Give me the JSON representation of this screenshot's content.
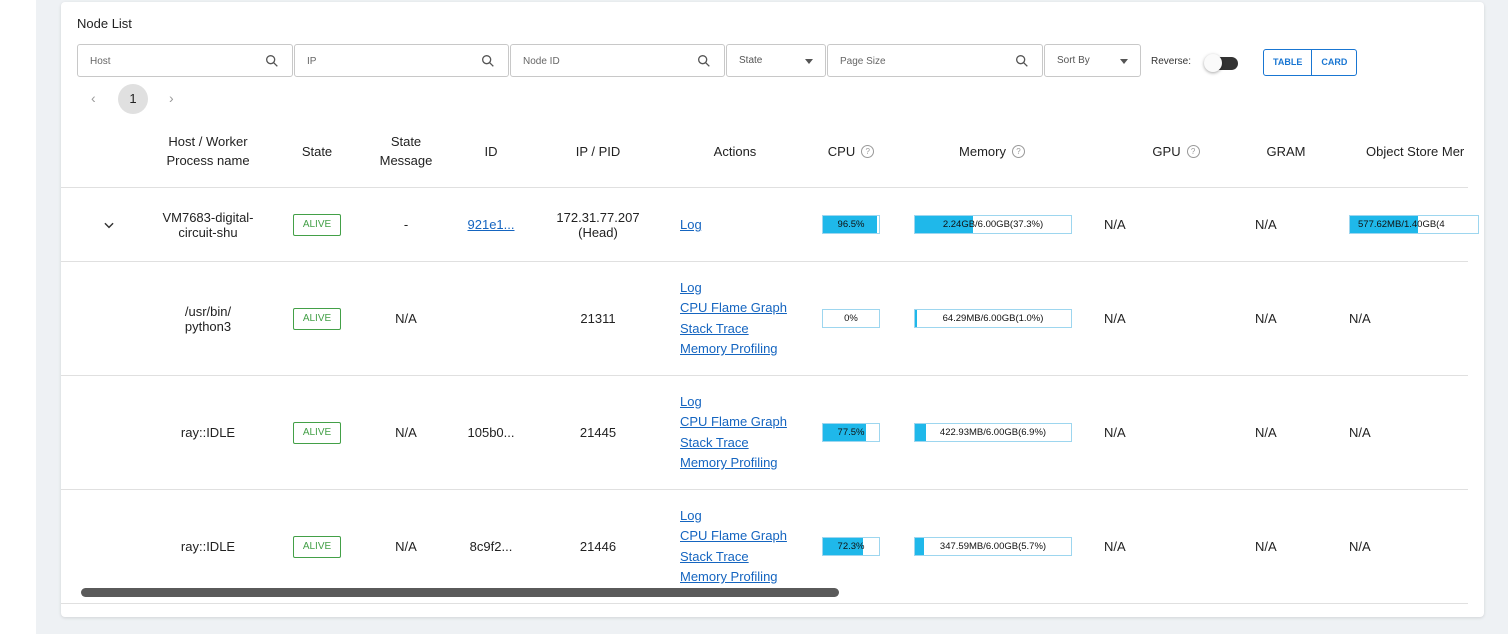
{
  "card_title": "Node List",
  "filters": {
    "host": {
      "placeholder": "Host"
    },
    "ip": {
      "placeholder": "IP"
    },
    "node_id": {
      "placeholder": "Node ID"
    },
    "state": {
      "value": "State"
    },
    "page_size": {
      "placeholder": "Page Size"
    },
    "sort_by": {
      "value": "Sort By"
    },
    "reverse_label": "Reverse:",
    "reverse_on": false,
    "view_table": "TABLE",
    "view_card": "CARD"
  },
  "pagination": {
    "prev": "‹",
    "current": "1",
    "next": "›"
  },
  "columns": {
    "host": [
      "Host / Worker",
      "Process name"
    ],
    "state": "State",
    "state_message": [
      "State",
      "Message"
    ],
    "id": "ID",
    "ip_pid": "IP / PID",
    "actions": "Actions",
    "cpu": "CPU",
    "memory": "Memory",
    "gpu": "GPU",
    "gram": "GRAM",
    "object_store": "Object Store Mer"
  },
  "node_row": {
    "host": [
      "VM7683-digital-",
      "circuit-shu"
    ],
    "state": "ALIVE",
    "state_message": "-",
    "id": "921e1...",
    "ip": [
      "172.31.77.207",
      "(Head)"
    ],
    "action": "Log",
    "cpu": {
      "text": "96.5%",
      "fraction": 0.965
    },
    "memory": {
      "text_filled": "2.24GB",
      "text_rest": "/6.00GB(37.3%)",
      "fraction": 0.373
    },
    "gpu": "N/A",
    "gram": "N/A",
    "object_store": {
      "text_filled": "577.62MB",
      "text_rest": "/1.40GB(4",
      "fraction": 0.53
    }
  },
  "workers": [
    {
      "name": [
        "/usr/bin/",
        "python3"
      ],
      "state": "ALIVE",
      "state_message": "N/A",
      "id": "",
      "pid": "21311",
      "actions": [
        "Log",
        "CPU Flame Graph",
        "Stack Trace",
        "Memory Profiling"
      ],
      "cpu": {
        "text": "0%",
        "fraction": 0.0
      },
      "memory": {
        "text": "64.29MB/6.00GB(1.0%)",
        "fraction": 0.01
      },
      "gpu": "N/A",
      "gram": "N/A",
      "object_store": "N/A"
    },
    {
      "name": [
        "ray::IDLE"
      ],
      "state": "ALIVE",
      "state_message": "N/A",
      "id": "105b0...",
      "pid": "21445",
      "actions": [
        "Log",
        "CPU Flame Graph",
        "Stack Trace",
        "Memory Profiling"
      ],
      "cpu": {
        "text": "77.5%",
        "fraction": 0.775
      },
      "memory": {
        "text": "422.93MB/6.00GB(6.9%)",
        "fraction": 0.069
      },
      "gpu": "N/A",
      "gram": "N/A",
      "object_store": "N/A"
    },
    {
      "name": [
        "ray::IDLE"
      ],
      "state": "ALIVE",
      "state_message": "N/A",
      "id": "8c9f2...",
      "pid": "21446",
      "actions": [
        "Log",
        "CPU Flame Graph",
        "Stack Trace",
        "Memory Profiling"
      ],
      "cpu": {
        "text": "72.3%",
        "fraction": 0.723
      },
      "memory": {
        "text": "347.59MB/6.00GB(5.7%)",
        "fraction": 0.057
      },
      "gpu": "N/A",
      "gram": "N/A",
      "object_store": "N/A"
    }
  ],
  "colors": {
    "accent": "#1976d2",
    "bar_fill": "#1fb8ea",
    "alive": "#43a047",
    "link": "#1565c0"
  },
  "icons": {
    "search": "search-icon",
    "expand": "chevron-down-icon",
    "help": "help-circle-icon"
  }
}
